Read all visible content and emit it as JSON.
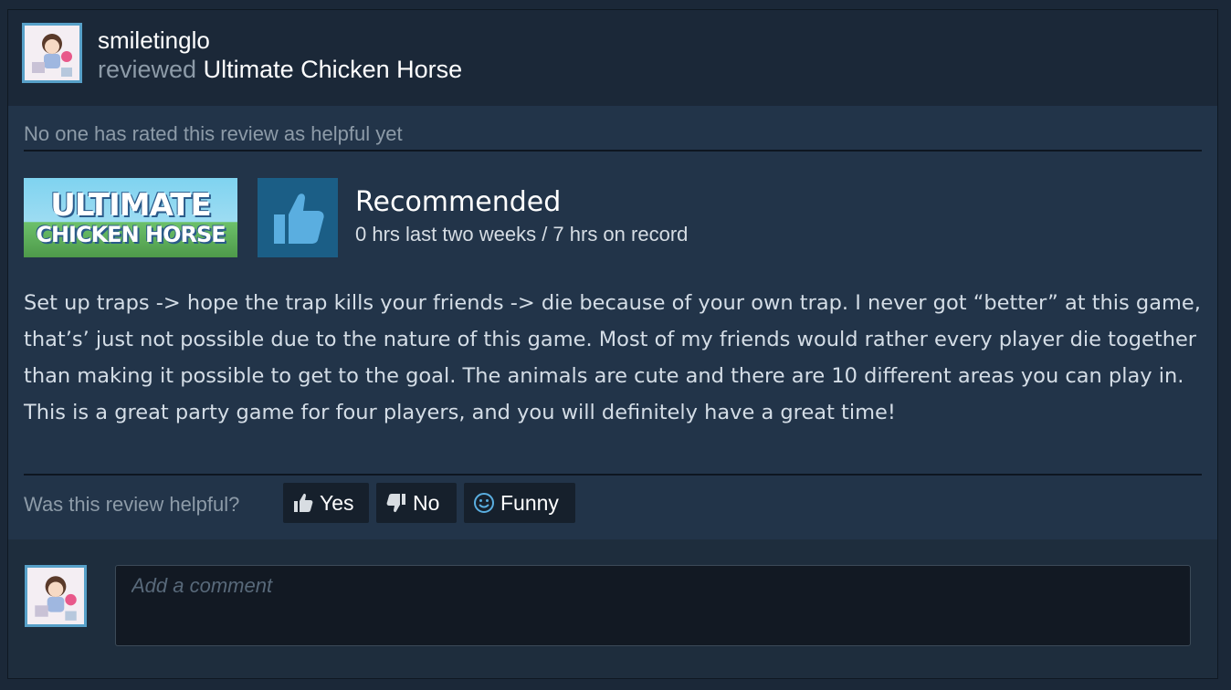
{
  "review": {
    "username": "smiletinglo",
    "reviewed_word": "reviewed",
    "game_name": "Ultimate Chicken Horse",
    "helpful_count_text": "No one has rated this review as helpful yet",
    "banner_line1": "ULTIMATE",
    "banner_line2": "CHICKEN HORSE",
    "verdict": "Recommended",
    "hours": "0 hrs last two weeks / 7 hrs on record",
    "text": "Set up traps -> hope the trap kills your friends -> die because of your own trap. I never got “better” at this game, that’s’ just not possible due to the nature of this game. Most of my friends would rather every player die together than making it possible to get to the goal. The animals are cute and there are 10 different areas you can play in. This is a great party game for four players, and you will definitely have a great time!"
  },
  "feedback": {
    "question": "Was this review helpful?",
    "yes_label": "Yes",
    "no_label": "No",
    "funny_label": "Funny"
  },
  "comment": {
    "placeholder": "Add a comment"
  },
  "icons": {
    "thumbs_up": "thumbs-up-icon",
    "thumbs_down": "thumbs-down-icon",
    "smiley": "smiley-icon"
  },
  "colors": {
    "accent_blue": "#57a0c8",
    "thumb_bg": "#1b5e86",
    "thumb": "#5aaee0"
  }
}
